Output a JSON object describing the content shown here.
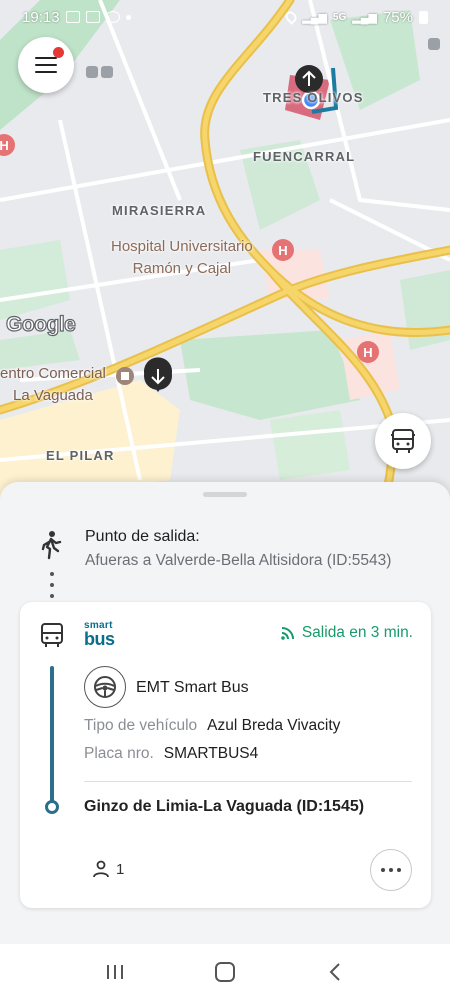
{
  "status_bar": {
    "time": "19:13",
    "battery": "75%",
    "network": "5G"
  },
  "map": {
    "labels": {
      "tres_olivos": "TRES OLIVOS",
      "fuencarral": "FUENCARRAL",
      "mirasierra": "MIRASIERRA",
      "el_pilar": "EL PILAR",
      "hospital": "Hospital Universitario\nRamón y Cajal",
      "centro_comercial": "entro Comercial\nLa Vaguada"
    },
    "google_logo": "Google",
    "colors": {
      "road_major": "#f6d56a",
      "park": "#bfe3c9",
      "base": "#e8eaed"
    }
  },
  "sheet": {
    "departure": {
      "title": "Punto de salida:",
      "value": "Afueras a Valverde-Bella Altisidora (ID:5543)"
    },
    "card": {
      "brand_line1": "smart",
      "brand_line2": "bus",
      "eta": "Salida en 3 min.",
      "operator": "EMT Smart Bus",
      "vehicle_type_label": "Tipo de vehículo",
      "vehicle_type_value": "Azul Breda Vivacity",
      "plate_label": "Placa nro.",
      "plate_value": "SMARTBUS4",
      "destination": "Ginzo de Limia-La Vaguada (ID:1545)",
      "passengers": "1"
    }
  },
  "colors": {
    "accent": "#2b6f8a",
    "eta_green": "#1a9a6c",
    "notification": "#e53935"
  }
}
